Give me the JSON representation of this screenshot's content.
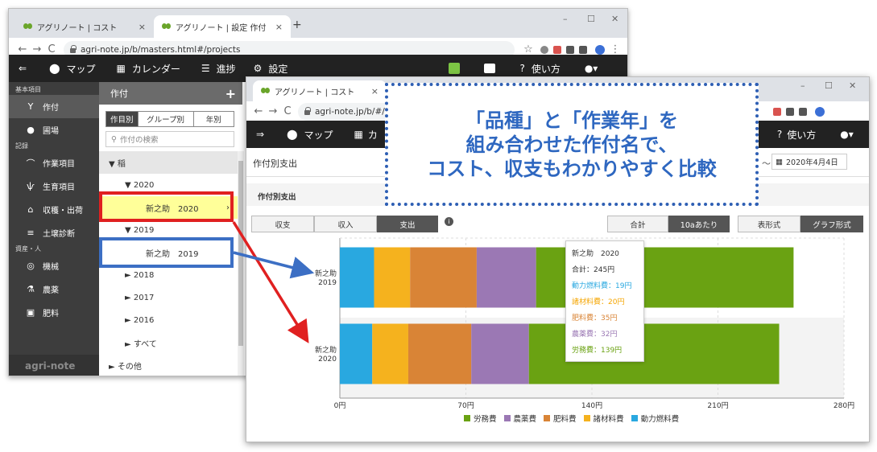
{
  "back_window": {
    "tabs": [
      {
        "label": "アグリノート | コスト",
        "close": "×"
      },
      {
        "label": "アグリノート | 設定 作付",
        "close": "×"
      }
    ],
    "new_tab": "+",
    "window_controls": [
      "–",
      "☐",
      "✕"
    ],
    "url": "agri-note.jp/b/masters.html#/projects",
    "nav": {
      "menu_icon": "⇐",
      "items": [
        "マップ",
        "カレンダー",
        "進捗",
        "設定"
      ],
      "help": "使い方"
    },
    "sidebar": {
      "sections": [
        {
          "title": "基本項目",
          "items": [
            "作付",
            "圃場"
          ]
        },
        {
          "title": "記録",
          "items": [
            "作業項目",
            "生育項目",
            "収穫・出荷",
            "土壌診断"
          ]
        },
        {
          "title": "資産・人",
          "items": [
            "機械",
            "農薬",
            "肥料"
          ]
        }
      ],
      "logo": "agri-note"
    },
    "panel": {
      "title": "作付",
      "add_icon": "+",
      "tabs": [
        "作目別",
        "グループ別",
        "年別"
      ],
      "search_placeholder": "作付の検索",
      "tree": {
        "root": "▼ 稲",
        "y2020": "▼ 2020",
        "item2020": "新之助　2020",
        "y2019": "▼ 2019",
        "item2019": "新之助　2019",
        "y2018": "► 2018",
        "y2017": "► 2017",
        "y2016": "► 2016",
        "all": "► すべて",
        "other": "► その他"
      }
    }
  },
  "front_window": {
    "tab": {
      "label": "アグリノート | コスト",
      "close": "×"
    },
    "window_controls": [
      "–",
      "☐",
      "✕"
    ],
    "url": "agri-note.jp/b/#/",
    "nav": {
      "items": [
        "マップ",
        "カ"
      ],
      "help": "使い方"
    },
    "page_title": "作付別支出",
    "date_sep": "〜",
    "date": "2020年4月4日",
    "section_title": "作付別支出",
    "buttons": {
      "mode": [
        "収支",
        "収入",
        "支出"
      ],
      "unit": [
        "合計",
        "10aあたり"
      ],
      "view": [
        "表形式",
        "グラフ形式"
      ]
    },
    "tooltip": {
      "title": "新之助　2020",
      "total": "合計：245円",
      "lines": [
        "動力燃料費：19円",
        "諸材料費：20円",
        "肥料費：35円",
        "農薬費：32円",
        "労務費：139円"
      ]
    }
  },
  "callout": {
    "lines": [
      "「品種」と「作業年」を",
      "組み合わせた作付名で、",
      "コスト、収支もわかりやすく比較"
    ]
  },
  "colors": {
    "fuel": "#29a8e0",
    "materials": "#f5b21e",
    "fertilizer": "#d98436",
    "pesticide": "#9b78b4",
    "labor": "#6aa212",
    "highlight_red": "#e02020",
    "highlight_blue": "#3c6fc4"
  },
  "chart_data": {
    "type": "bar",
    "orientation": "horizontal",
    "stacked": true,
    "categories": [
      "新之助\n2019",
      "新之助\n2020"
    ],
    "series": [
      {
        "name": "動力燃料費",
        "color": "#29a8e0",
        "values": [
          19,
          18
        ]
      },
      {
        "name": "諸材料費",
        "color": "#f5b21e",
        "values": [
          20,
          20
        ]
      },
      {
        "name": "肥料費",
        "color": "#d98436",
        "values": [
          37,
          35
        ]
      },
      {
        "name": "農薬費",
        "color": "#9b78b4",
        "values": [
          33,
          32
        ]
      },
      {
        "name": "労務費",
        "color": "#6aa212",
        "values": [
          143,
          139
        ]
      }
    ],
    "xlim": [
      0,
      280
    ],
    "xticks": [
      "0円",
      "70円",
      "140円",
      "210円",
      "280円"
    ],
    "legend_order": [
      "労務費",
      "農薬費",
      "肥料費",
      "諸材料費",
      "動力燃料費"
    ],
    "legend": "bottom",
    "grid": true
  }
}
